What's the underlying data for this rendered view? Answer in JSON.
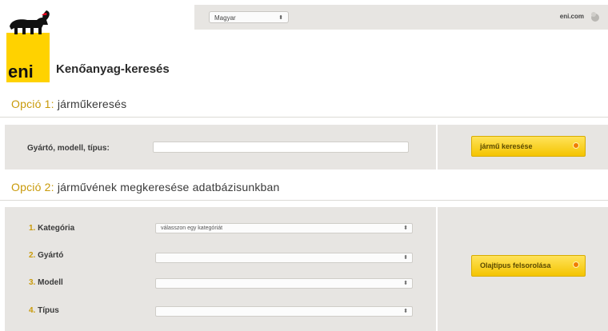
{
  "header": {
    "language_select": "Magyar",
    "site_link": "eni.com",
    "logo_text": "eni"
  },
  "page": {
    "title": "Kenőanyag-keresés"
  },
  "option1": {
    "prefix": "Opció 1:",
    "heading": "járműkeresés",
    "field_label": "Gyártó, modell, típus:",
    "input_value": "",
    "button_label": "jármű keresése"
  },
  "option2": {
    "prefix": "Opció 2:",
    "heading": "járművének megkeresése adatbázisunkban",
    "fields": [
      {
        "num": "1.",
        "label": "Kategória",
        "value": "válasszon egy kategóriát"
      },
      {
        "num": "2.",
        "label": "Gyártó",
        "value": ""
      },
      {
        "num": "3.",
        "label": "Modell",
        "value": ""
      },
      {
        "num": "4.",
        "label": "Típus",
        "value": ""
      }
    ],
    "button_label": "Olajtípus felsorolása"
  },
  "colors": {
    "accent_yellow": "#f4c400",
    "panel_grey": "#e7e5e2",
    "number_gold": "#c99a0a",
    "button_dot": "#f07d00"
  }
}
